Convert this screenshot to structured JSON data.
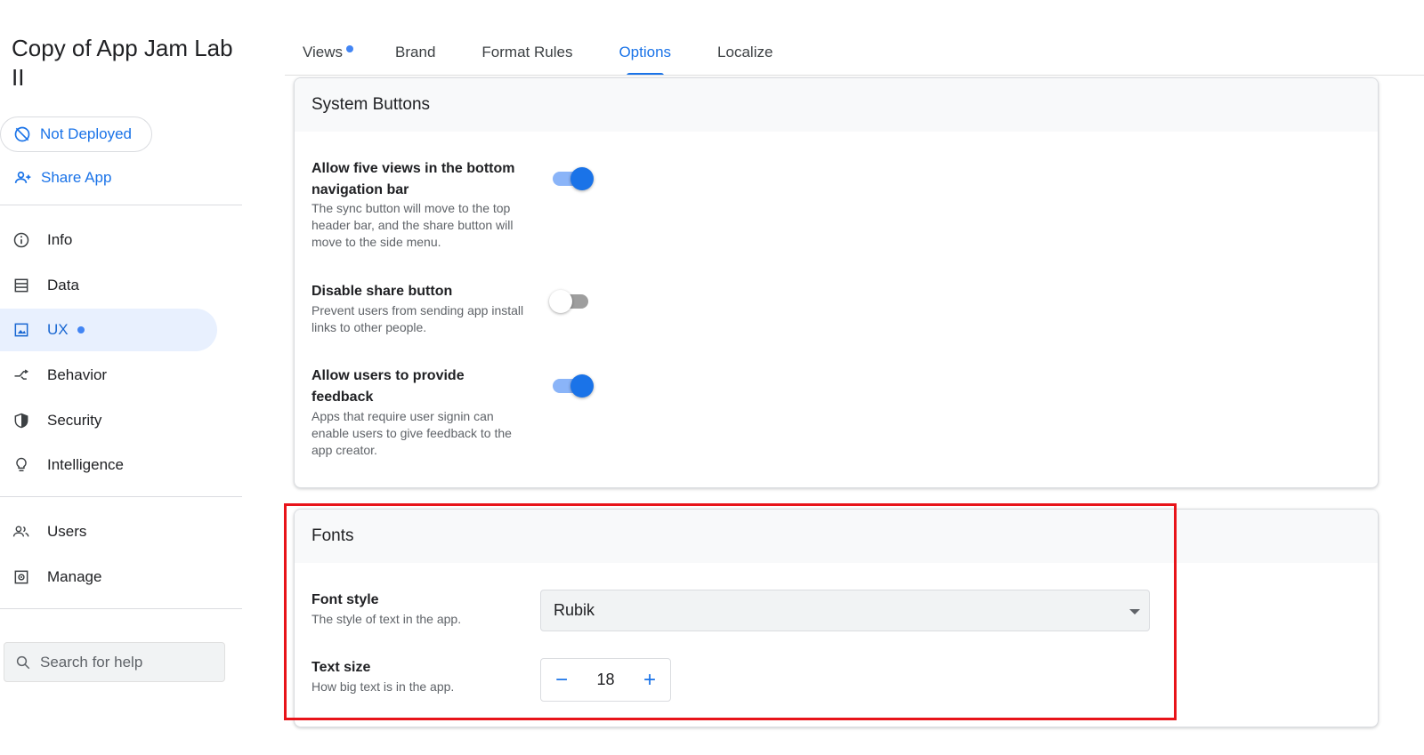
{
  "app": {
    "title": "Copy of App Jam Lab II"
  },
  "sidebar": {
    "deploy_status": "Not Deployed",
    "share_label": "Share App",
    "nav": [
      {
        "label": "Info",
        "icon": "info-icon"
      },
      {
        "label": "Data",
        "icon": "table-icon"
      },
      {
        "label": "UX",
        "icon": "image-icon",
        "active": true,
        "has_dot": true
      },
      {
        "label": "Behavior",
        "icon": "branch-icon"
      },
      {
        "label": "Security",
        "icon": "shield-icon"
      },
      {
        "label": "Intelligence",
        "icon": "lightbulb-icon"
      }
    ],
    "nav_secondary": [
      {
        "label": "Users",
        "icon": "users-icon"
      },
      {
        "label": "Manage",
        "icon": "manage-icon"
      }
    ],
    "search_placeholder": "Search for help"
  },
  "tabs": [
    {
      "label": "Views",
      "has_dot": true
    },
    {
      "label": "Brand"
    },
    {
      "label": "Format Rules"
    },
    {
      "label": "Options",
      "active": true
    },
    {
      "label": "Localize"
    }
  ],
  "system_buttons": {
    "header": "System Buttons",
    "settings": [
      {
        "title": "Allow five views in the bottom navigation bar",
        "desc": "The sync button will move to the top header bar, and the share button will move to the side menu.",
        "enabled": true
      },
      {
        "title": "Disable share button",
        "desc": "Prevent users from sending app install links to other people.",
        "enabled": false
      },
      {
        "title": "Allow users to provide feedback",
        "desc": "Apps that require user signin can enable users to give feedback to the app creator.",
        "enabled": true
      }
    ]
  },
  "fonts": {
    "header": "Fonts",
    "font_style": {
      "title": "Font style",
      "desc": "The style of text in the app.",
      "value": "Rubik"
    },
    "text_size": {
      "title": "Text size",
      "desc": "How big text is in the app.",
      "value": "18",
      "minus": "−",
      "plus": "+"
    }
  },
  "colors": {
    "accent": "#1a73e8",
    "active_nav_bg": "#e8f0fe",
    "highlight": "#e8141a",
    "dot": "#4285f4"
  }
}
